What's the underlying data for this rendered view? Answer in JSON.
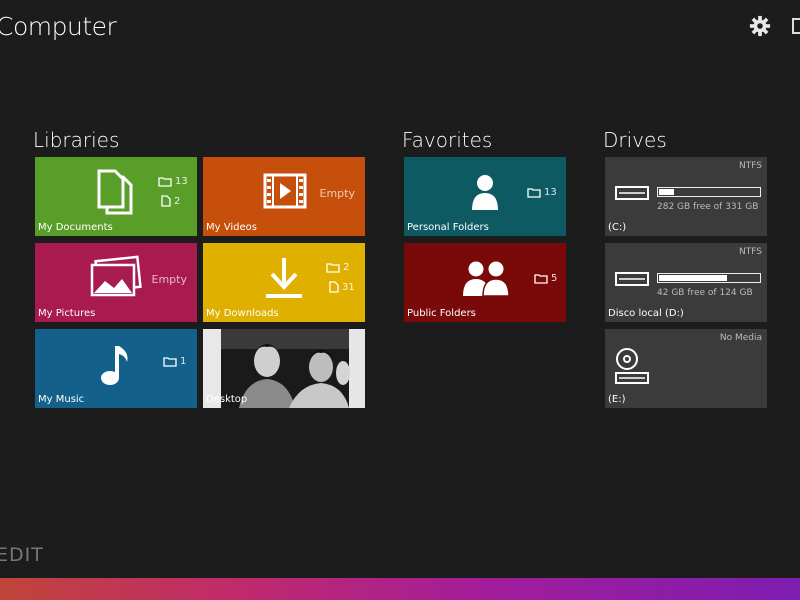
{
  "header": {
    "title": "Computer",
    "settings_icon": "gear-icon"
  },
  "sections": {
    "libraries": "Libraries",
    "favorites": "Favorites",
    "drives": "Drives"
  },
  "libraries": {
    "documents": {
      "label": "My Documents",
      "folders": "13",
      "files": "2",
      "color": "#5a9e2a"
    },
    "videos": {
      "label": "My Videos",
      "empty": "Empty",
      "color": "#c64f0c"
    },
    "pictures": {
      "label": "My Pictures",
      "empty": "Empty",
      "color": "#a91a4e"
    },
    "downloads": {
      "label": "My Downloads",
      "folders": "2",
      "files": "31",
      "color": "#e0b000"
    },
    "music": {
      "label": "My Music",
      "folders": "1",
      "color": "#13618a"
    },
    "desktop": {
      "label": "Desktop"
    }
  },
  "favorites": {
    "personal": {
      "label": "Personal Folders",
      "folders": "13",
      "color": "#0e5a63"
    },
    "public": {
      "label": "Public Folders",
      "folders": "5",
      "color": "#7a0909"
    }
  },
  "drives": [
    {
      "label": "(C:)",
      "fs": "NTFS",
      "free": "282 GB free of 331 GB",
      "used_fraction": 0.15
    },
    {
      "label": "Disco local (D:)",
      "fs": "NTFS",
      "free": "42 GB free of 124 GB",
      "used_fraction": 0.68
    },
    {
      "label": "(E:)",
      "fs": "No Media"
    }
  ],
  "footer": {
    "edit": "EDIT"
  }
}
